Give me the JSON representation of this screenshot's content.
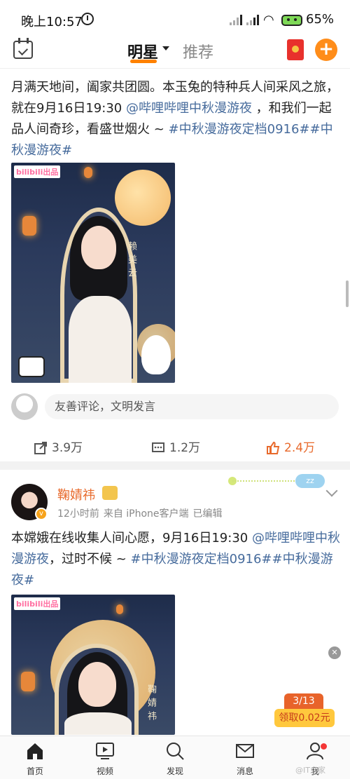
{
  "status": {
    "time": "晚上10:57",
    "battery": "65%"
  },
  "nav": {
    "active_tab": "明星",
    "inactive_tab": "推荐"
  },
  "post1": {
    "text_parts": [
      "月满天地间，阖家共团圆。本玉兔的特种兵人间采风之旅，就在9月16日19:30 ",
      "@哔哩哔哩中秋漫游夜",
      " ，和我们一起品人间奇珍，看盛世烟火 ~ ",
      "#中秋漫游夜定档0916#",
      "",
      "#中秋漫游夜#"
    ],
    "poster_logo": "bilibili出品",
    "poster_name": "赖美云"
  },
  "comment": {
    "placeholder": "友善评论，文明发言"
  },
  "actions": {
    "repost": "3.9万",
    "comment": "1.2万",
    "like": "2.4万"
  },
  "post2": {
    "username": "鞠婧祎",
    "time": "12小时前",
    "source": "来自 iPhone客户端",
    "edited": "已编辑",
    "text_parts": [
      "本嫦娥在线收集人间心愿，9月16日19:30 ",
      "@哔哩哔哩中秋漫游夜",
      "，过时不候 ~ ",
      "#中秋漫游夜定档0916#",
      "#中秋漫游夜#"
    ],
    "poster_logo": "bilibili出品",
    "poster_name": "鞠婧祎"
  },
  "promo": {
    "progress": "3/13",
    "claim": "领取0.02元"
  },
  "tabbar": {
    "items": [
      "首页",
      "视频",
      "发现",
      "消息",
      "我"
    ]
  },
  "watermark": "@IT之家",
  "colors": {
    "accent": "#ff8200",
    "link": "#466b9c",
    "like": "#e86a2c"
  }
}
